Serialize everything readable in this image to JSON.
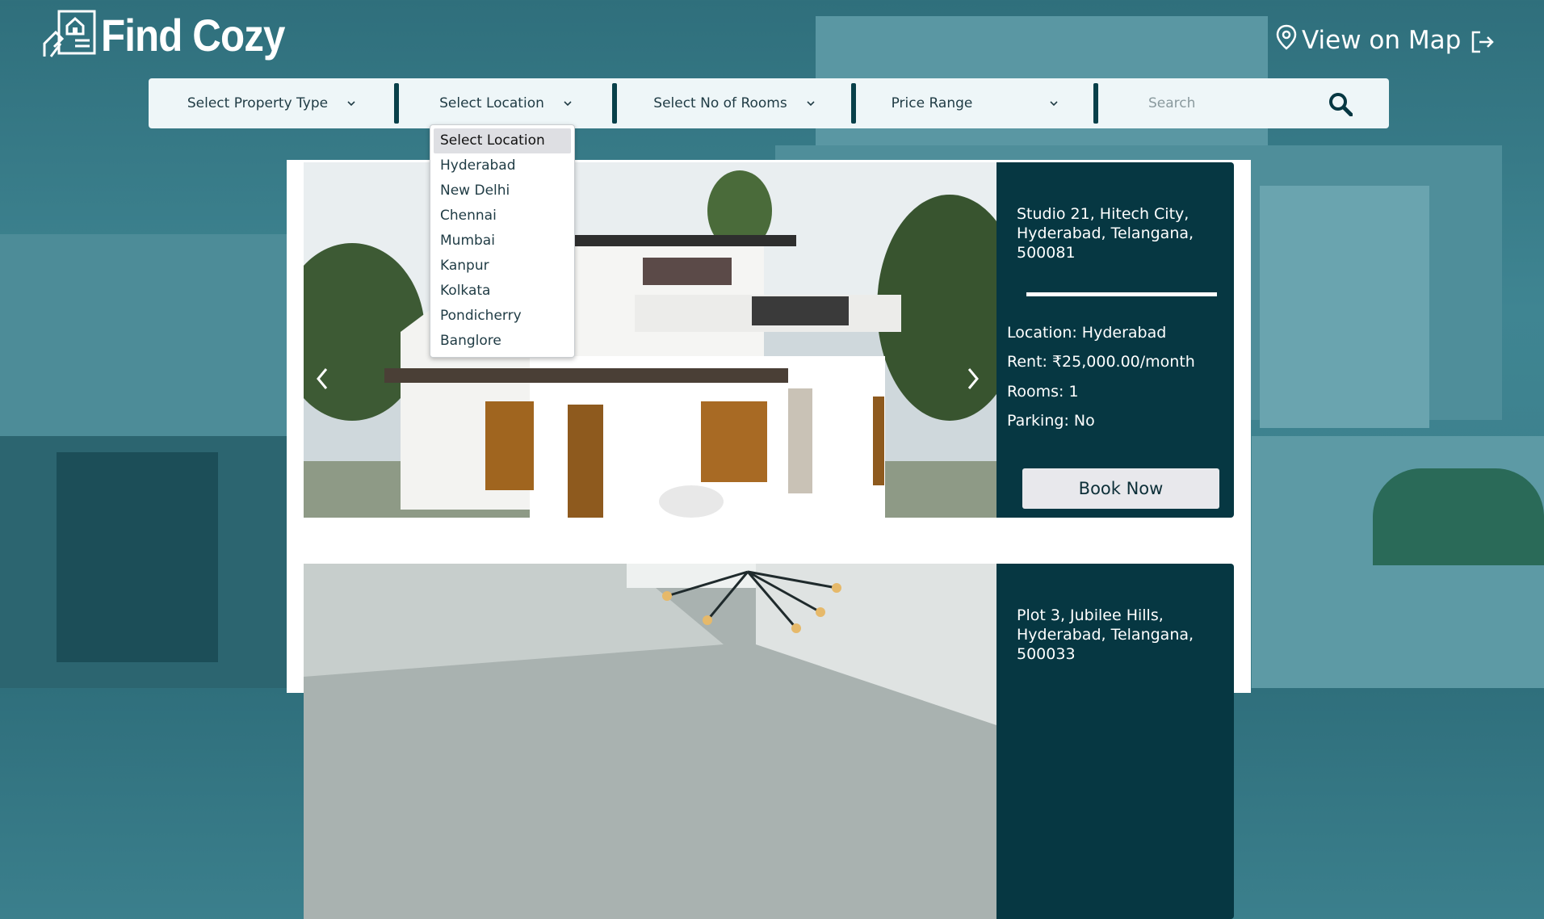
{
  "header": {
    "logo_text": "Find Cozy",
    "map_link": "View on Map",
    "icons": {
      "logo": "house-hand-icon",
      "map": "map-pin-icon",
      "logout": "logout-icon"
    }
  },
  "filters": {
    "property_type": "Select Property Type",
    "location": "Select Location",
    "rooms": "Select No of Rooms",
    "price": "Price Range",
    "search_placeholder": "Search"
  },
  "location_dropdown": {
    "options": [
      "Select Location",
      "Hyderabad",
      "New Delhi",
      "Chennai",
      "Mumbai",
      "Kanpur",
      "Kolkata",
      "Pondicherry",
      "Banglore"
    ],
    "selected": "Select Location"
  },
  "listings": [
    {
      "address": "Studio 21, Hitech City, Hyderabad, Telangana, 500081",
      "location": "Location: Hyderabad",
      "rent": "Rent: ₹25,000.00/month",
      "rooms": "Rooms: 1",
      "parking": "Parking: No",
      "button": "Book Now"
    },
    {
      "address": "Plot 3, Jubilee Hills, Hyderabad, Telangana, 500033"
    }
  ],
  "colors": {
    "accent": "#063742",
    "filter_bg": "#eef6f8",
    "background": "#3f8592"
  }
}
